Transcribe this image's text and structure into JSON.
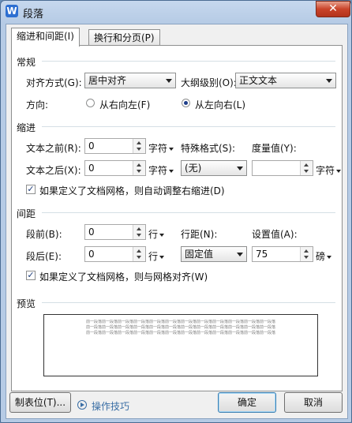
{
  "window": {
    "app_icon": "W",
    "title": "段落",
    "close_glyph": "✕"
  },
  "tabs": [
    {
      "label": "缩进和间距(I)",
      "active": true
    },
    {
      "label": "换行和分页(P)",
      "active": false
    }
  ],
  "general": {
    "section_label": "常规",
    "alignment_label": "对齐方式(G):",
    "alignment_value": "居中对齐",
    "outline_label": "大纲级别(O):",
    "outline_value": "正文文本",
    "direction_label": "方向:",
    "rtl_label": "从右向左(F)",
    "ltr_label": "从左向右(L)"
  },
  "indent": {
    "section_label": "缩进",
    "before_label": "文本之前(R):",
    "before_value": "0",
    "before_unit": "字符",
    "after_label": "文本之后(X):",
    "after_value": "0",
    "after_unit": "字符",
    "special_label": "特殊格式(S):",
    "special_value": "(无)",
    "measure_label": "度量值(Y):",
    "measure_value": "",
    "measure_unit": "字符",
    "grid_check_label": "如果定义了文档网格，则自动调整右缩进(D)",
    "grid_checked": true
  },
  "spacing": {
    "section_label": "间距",
    "before_label": "段前(B):",
    "before_value": "0",
    "before_unit": "行",
    "after_label": "段后(E):",
    "after_value": "0",
    "after_unit": "行",
    "line_label": "行距(N):",
    "line_value": "固定值",
    "setting_label": "设置值(A):",
    "setting_value": "75",
    "setting_unit": "磅",
    "grid_check_label": "如果定义了文档网格，则与网格对齐(W)",
    "grid_checked": true
  },
  "preview": {
    "section_label": "预览",
    "lines": [
      "前一段落前一段落前一段落前一段落前一段落前一段落前一段落前一段落前一段落前一段落前一段落前一段落",
      "前一段落前一段落前一段落前一段落前一段落前一段落前一段落前一段落前一段落前一段落前一段落前一段落",
      "前一段落前一段落前一段落前一段落前一段落前一段落前一段落前一段落前一段落前一段落前一段落前一段落"
    ]
  },
  "footer": {
    "tabs_button": "制表位(T)...",
    "tips_label": "操作技巧",
    "ok_button": "确定",
    "cancel_button": "取消"
  }
}
